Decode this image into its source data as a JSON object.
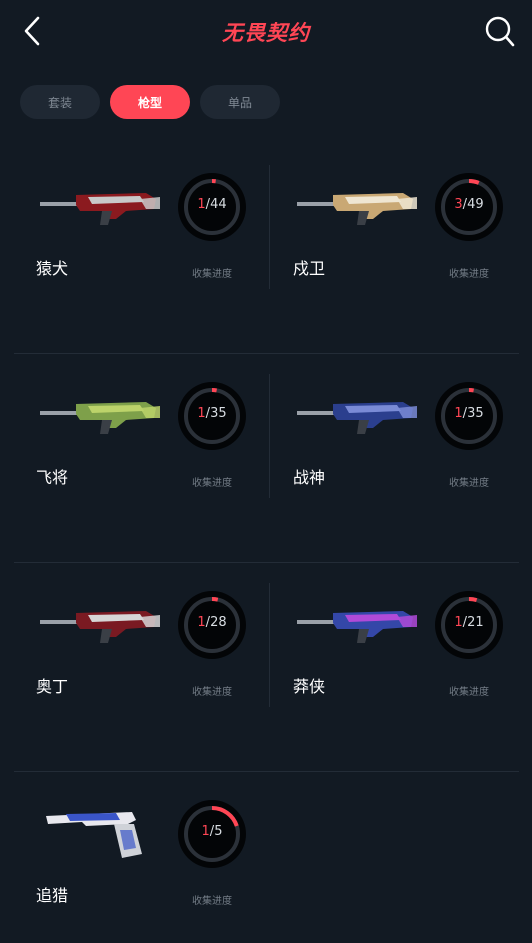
{
  "header": {
    "title": "无畏契约",
    "back_icon": "chevron-left-icon",
    "search_icon": "search-icon"
  },
  "tabs": [
    {
      "label": "套装",
      "active": false
    },
    {
      "label": "枪型",
      "active": true
    },
    {
      "label": "单品",
      "active": false
    }
  ],
  "accent_color": "#ff4655",
  "progress_label": "收集进度",
  "items": [
    {
      "name": "猿犬",
      "collected": "1",
      "total": "44",
      "gun_colors": [
        "#8b1a1f",
        "#c9c9c9"
      ]
    },
    {
      "name": "戍卫",
      "collected": "3",
      "total": "49",
      "gun_colors": [
        "#c9a874",
        "#efe6d2"
      ]
    },
    {
      "name": "飞将",
      "collected": "1",
      "total": "35",
      "gun_colors": [
        "#7ea04a",
        "#bcd36a"
      ]
    },
    {
      "name": "战神",
      "collected": "1",
      "total": "35",
      "gun_colors": [
        "#2b3f8e",
        "#7a8bd6"
      ]
    },
    {
      "name": "奥丁",
      "collected": "1",
      "total": "28",
      "gun_colors": [
        "#7a1a22",
        "#d6d6d6"
      ]
    },
    {
      "name": "莽侠",
      "collected": "1",
      "total": "21",
      "gun_colors": [
        "#3447a8",
        "#b04ad8"
      ]
    },
    {
      "name": "追猎",
      "collected": "1",
      "total": "5",
      "gun_colors": [
        "#3a55c8",
        "#e8e8ee"
      ]
    }
  ]
}
